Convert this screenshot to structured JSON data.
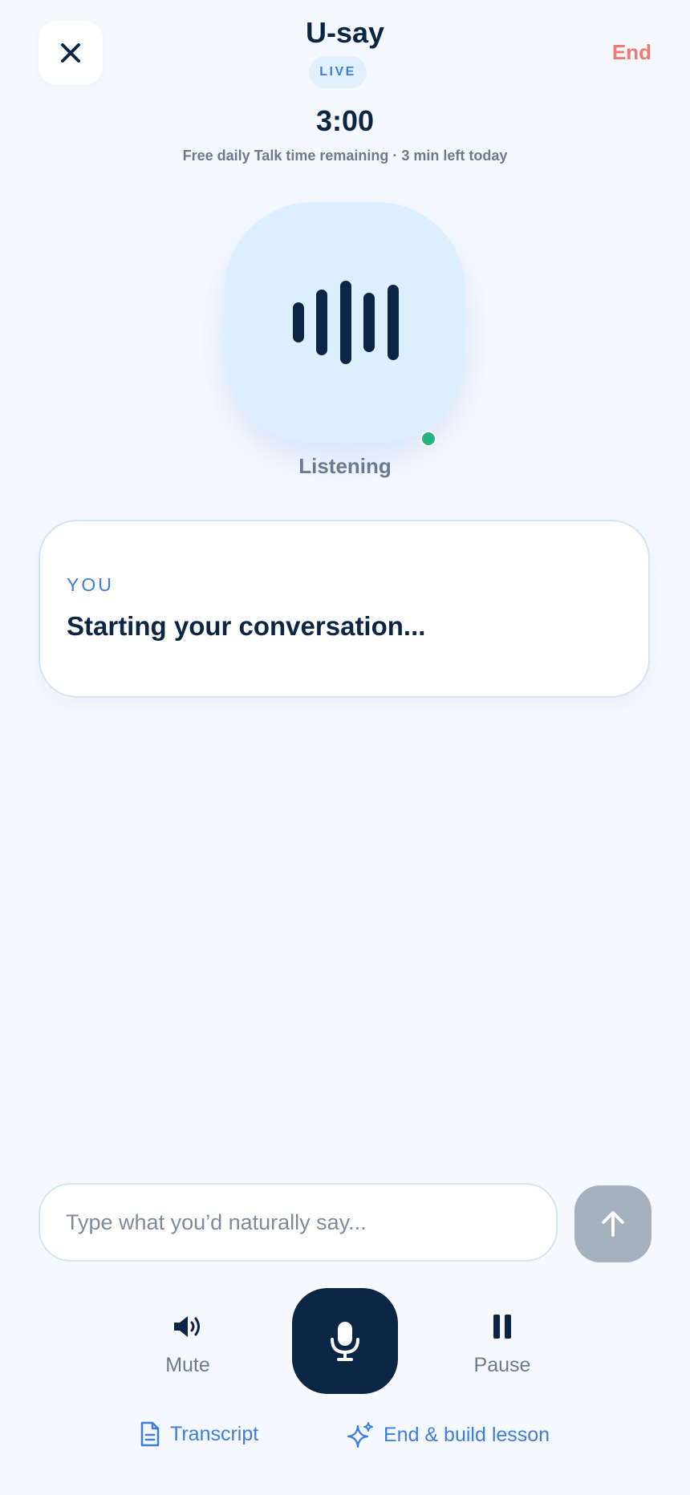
{
  "header": {
    "title": "U-say",
    "live_badge": "LIVE",
    "end_label": "End"
  },
  "timer": {
    "time": "3:00",
    "subtitle": "Free daily Talk time remaining · 3 min left today"
  },
  "orb": {
    "status": "Listening",
    "icon": "waveform-icon",
    "status_dot_color": "#26b57a"
  },
  "card": {
    "speaker": "YOU",
    "text": "Starting your conversation..."
  },
  "composer": {
    "placeholder": "Type what you’d naturally say...",
    "value": ""
  },
  "controls": {
    "mute_label": "Mute",
    "pause_label": "Pause"
  },
  "footer": {
    "transcript_label": "Transcript",
    "build_lesson_label": "End & build lesson"
  },
  "colors": {
    "background": "#f5f9ff",
    "primary": "#0b2545",
    "accent": "#3d7de0",
    "end": "#f07a6f",
    "orb": "#dcefff"
  }
}
